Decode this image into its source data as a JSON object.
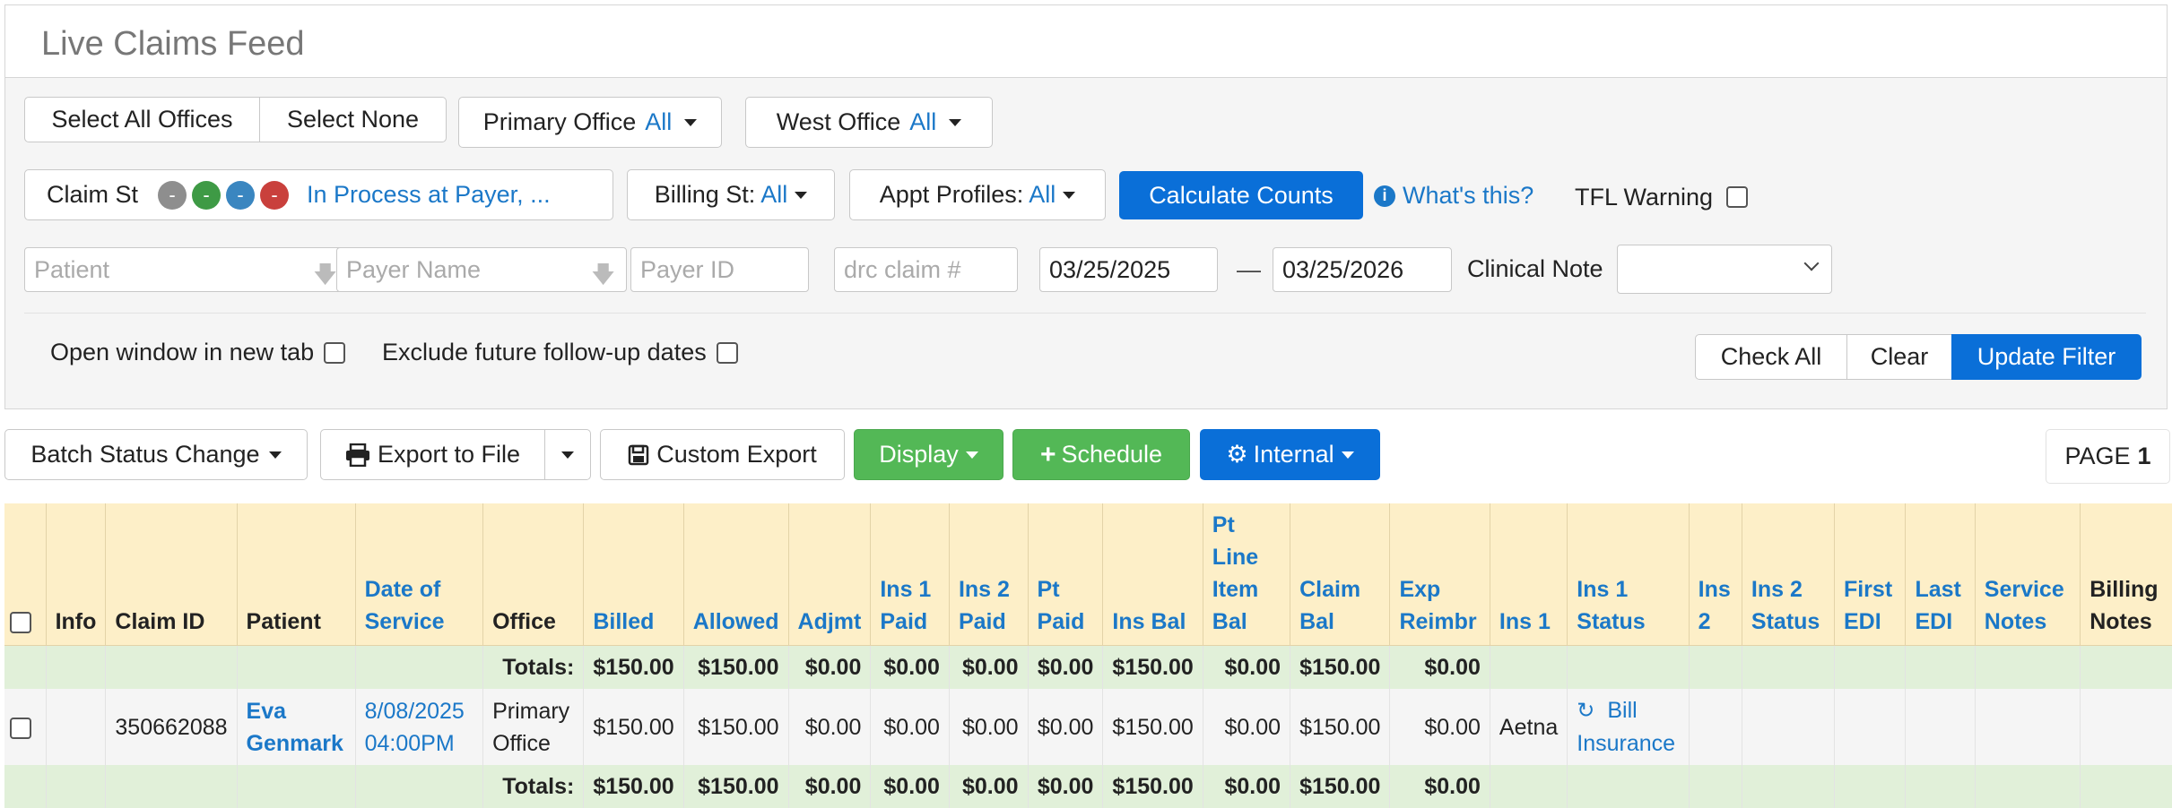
{
  "header": {
    "title": "Live Claims Feed"
  },
  "offices": {
    "select_all": "Select All Offices",
    "select_none": "Select None",
    "primary_label": "Primary Office",
    "primary_value": "All",
    "west_label": "West Office",
    "west_value": "All"
  },
  "filters": {
    "claim_st_label": "Claim St",
    "claim_st_dots": [
      "-",
      "-",
      "-",
      "-"
    ],
    "claim_st_value": "In Process at Payer, ...",
    "billing_label": "Billing St:",
    "billing_value": "All",
    "appt_label": "Appt Profiles:",
    "appt_value": "All",
    "calculate": "Calculate Counts",
    "whats_this": "What's this?",
    "tfl_warning": "TFL Warning",
    "patient_placeholder": "Patient",
    "payer_name_placeholder": "Payer Name",
    "payer_id_placeholder": "Payer ID",
    "drc_placeholder": "drc claim #",
    "date_from": "03/25/2025",
    "date_sep": "—",
    "date_to": "03/25/2026",
    "clinical_note_label": "Clinical Note",
    "open_new_tab": "Open window in new tab",
    "exclude_future": "Exclude future follow-up dates",
    "check_all": "Check All",
    "clear": "Clear",
    "update_filter": "Update Filter"
  },
  "toolbar": {
    "batch_status": "Batch Status Change",
    "export_file": "Export to File",
    "custom_export": "Custom Export",
    "display": "Display",
    "schedule": "Schedule",
    "internal": "Internal",
    "page_label": "PAGE",
    "page_number": "1"
  },
  "table": {
    "headers": {
      "info": "Info",
      "claim_id": "Claim ID",
      "patient": "Patient",
      "dos1": "Date of",
      "dos2": "Service",
      "office": "Office",
      "billed": "Billed",
      "allowed": "Allowed",
      "adjmt": "Adjmt",
      "ins1paid1": "Ins 1",
      "ins1paid2": "Paid",
      "ins2paid1": "Ins 2",
      "ins2paid2": "Paid",
      "ptpaid1": "Pt",
      "ptpaid2": "Paid",
      "insbal": "Ins Bal",
      "ptline1": "Pt",
      "ptline2": "Line",
      "ptline3": "Item",
      "ptline4": "Bal",
      "claimbal1": "Claim",
      "claimbal2": "Bal",
      "exp1": "Exp",
      "exp2": "Reimbr",
      "ins1": "Ins 1",
      "ins1st1": "Ins 1",
      "ins1st2": "Status",
      "ins2a": "Ins",
      "ins2b": "2",
      "ins2st1": "Ins 2",
      "ins2st2": "Status",
      "firstedi1": "First",
      "firstedi2": "EDI",
      "lastedi1": "Last",
      "lastedi2": "EDI",
      "svc1": "Service",
      "svc2": "Notes",
      "bill1": "Billing",
      "bill2": "Notes"
    },
    "totals": {
      "label": "Totals:",
      "billed": "$150.00",
      "allowed": "$150.00",
      "adjmt": "$0.00",
      "ins1paid": "$0.00",
      "ins2paid": "$0.00",
      "ptpaid": "$0.00",
      "insbal": "$150.00",
      "ptline": "$0.00",
      "claimbal": "$150.00",
      "exp": "$0.00"
    },
    "row": {
      "claim_id": "350662088",
      "patient1": "Eva",
      "patient2": "Genmark",
      "dos1": "8/08/2025",
      "dos2": "04:00PM",
      "office1": "Primary",
      "office2": "Office",
      "billed": "$150.00",
      "allowed": "$150.00",
      "adjmt": "$0.00",
      "ins1paid": "$0.00",
      "ins2paid": "$0.00",
      "ptpaid": "$0.00",
      "insbal": "$150.00",
      "ptline": "$0.00",
      "claimbal": "$150.00",
      "exp": "$0.00",
      "ins1": "Aetna",
      "ins1status1": "Bill",
      "ins1status2": "Insurance"
    }
  },
  "colors": {
    "accent": "#0a6fd8",
    "link": "#1b78c8",
    "header_bg": "#fdefc8",
    "totals_bg": "#e1f0d9",
    "green": "#53b856"
  },
  "icons": [
    "arrow-down-icon",
    "info-icon",
    "printer-icon",
    "save-icon",
    "plus-icon",
    "gear-icon",
    "refresh-icon"
  ]
}
